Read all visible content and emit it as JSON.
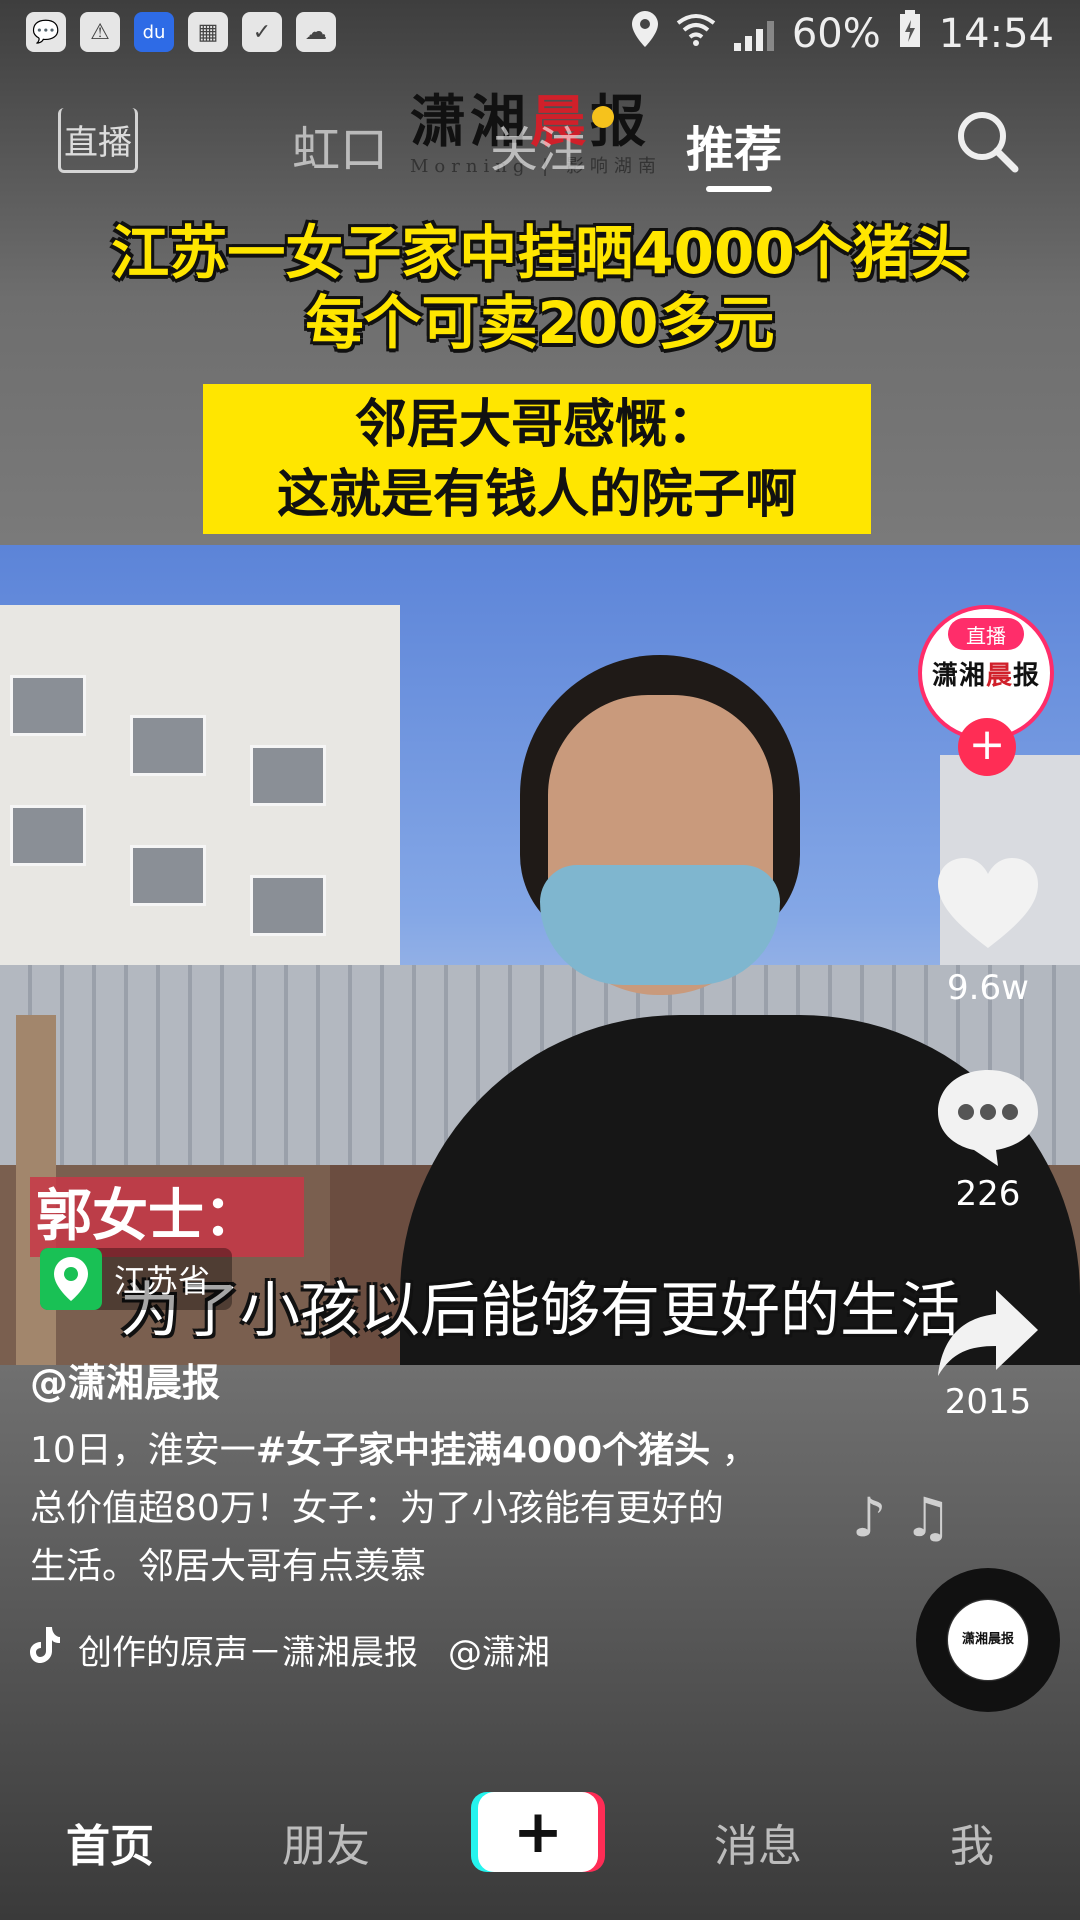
{
  "status_bar": {
    "battery": "60%",
    "time": "14:54",
    "left_icons": [
      "wechat-icon",
      "warning-icon",
      "baidu-icon",
      "calendar-icon",
      "check-icon",
      "cloud-icon"
    ],
    "baidu_label": "du"
  },
  "top_nav": {
    "live_label": "直播",
    "tabs": [
      {
        "label": "虹口"
      },
      {
        "label": "关注"
      },
      {
        "label": "推荐"
      }
    ],
    "active_tab": "推荐"
  },
  "watermark": {
    "name_a": "潇湘",
    "name_b": "晨",
    "name_c": "报",
    "sub": "Morning | 影响湖南"
  },
  "video": {
    "headline_line1": "江苏一女子家中挂晒4000个猪头",
    "headline_line2": "每个可卖200多元",
    "neighbor_line1": "邻居大哥感慨：",
    "neighbor_line2": "这就是有钱人的院子啊",
    "speaker": "郭女士：",
    "subtitle": "为了小孩以后能够有更好的生活",
    "location": "江苏省"
  },
  "right_rail": {
    "live_badge": "直播",
    "avatar_text_a": "潇湘",
    "avatar_text_b": "晨",
    "avatar_text_c": "报",
    "follow_symbol": "+",
    "likes": "9.6w",
    "comments": "226",
    "shares": "2015"
  },
  "caption": {
    "author": "@潇湘晨报",
    "desc_prefix": "10日，淮安一",
    "desc_hashtag": "#女子家中挂满4000个猪头",
    "desc_rest1": " ，",
    "desc_line2": "总价值超80万！女子：为了小孩能有更好的",
    "desc_line3": "生活。邻居大哥有点羡慕",
    "music": "创作的原声－潇湘晨报",
    "music_mention": "@潇湘",
    "music_notes": "♪ ♫",
    "disc_label": "潇湘晨报"
  },
  "bottom_nav": {
    "home": "首页",
    "friends": "朋友",
    "plus": "+",
    "messages": "消息",
    "me": "我"
  },
  "colors": {
    "accent_pink": "#ff2d55",
    "caption_yellow": "#ffe600",
    "location_green": "#19c155"
  }
}
